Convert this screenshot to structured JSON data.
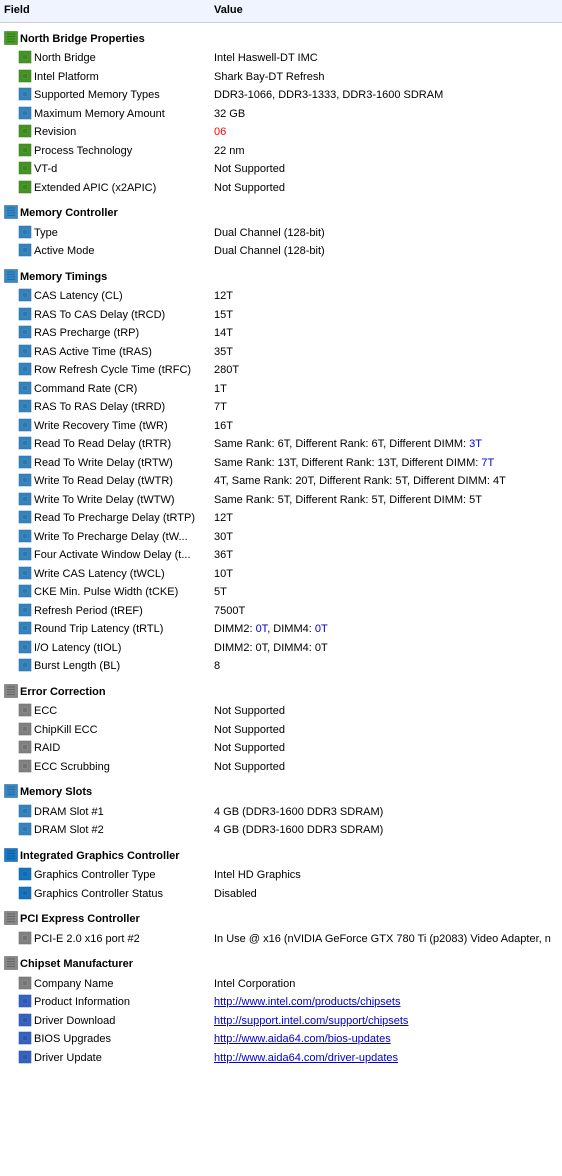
{
  "columns": {
    "field": "Field",
    "value": "Value"
  },
  "sections": [
    {
      "id": "north-bridge-properties",
      "label": "North Bridge Properties",
      "icon": "chip",
      "indent": 0,
      "rows": [
        {
          "field": "North Bridge",
          "value": "Intel Haswell-DT IMC",
          "indent": 1,
          "icon": "chip"
        },
        {
          "field": "Intel Platform",
          "value": "Shark Bay-DT Refresh",
          "indent": 1,
          "icon": "chip"
        },
        {
          "field": "Supported Memory Types",
          "value": "DDR3-1066, DDR3-1333, DDR3-1600 SDRAM",
          "indent": 1,
          "icon": "timing",
          "valueHighlight": "DDR3-1600"
        },
        {
          "field": "Maximum Memory Amount",
          "value": "32 GB",
          "indent": 1,
          "icon": "timing"
        },
        {
          "field": "Revision",
          "value": "06",
          "indent": 1,
          "icon": "chip",
          "valueColor": "red"
        },
        {
          "field": "Process Technology",
          "value": "22 nm",
          "indent": 1,
          "icon": "chip"
        },
        {
          "field": "VT-d",
          "value": "Not Supported",
          "indent": 1,
          "icon": "chip"
        },
        {
          "field": "Extended APIC (x2APIC)",
          "value": "Not Supported",
          "indent": 1,
          "icon": "chip"
        }
      ]
    },
    {
      "id": "memory-controller",
      "label": "Memory Controller",
      "icon": "timing",
      "indent": 0,
      "rows": [
        {
          "field": "Type",
          "value": "Dual Channel  (128-bit)",
          "indent": 1,
          "icon": "timing"
        },
        {
          "field": "Active Mode",
          "value": "Dual Channel  (128-bit)",
          "indent": 1,
          "icon": "timing"
        }
      ]
    },
    {
      "id": "memory-timings",
      "label": "Memory Timings",
      "icon": "timing",
      "indent": 0,
      "rows": [
        {
          "field": "CAS Latency (CL)",
          "value": "12T",
          "indent": 1,
          "icon": "timing"
        },
        {
          "field": "RAS To CAS Delay (tRCD)",
          "value": "15T",
          "indent": 1,
          "icon": "timing"
        },
        {
          "field": "RAS Precharge (tRP)",
          "value": "14T",
          "indent": 1,
          "icon": "timing"
        },
        {
          "field": "RAS Active Time (tRAS)",
          "value": "35T",
          "indent": 1,
          "icon": "timing"
        },
        {
          "field": "Row Refresh Cycle Time (tRFC)",
          "value": "280T",
          "indent": 1,
          "icon": "timing"
        },
        {
          "field": "Command Rate (CR)",
          "value": "1T",
          "indent": 1,
          "icon": "timing"
        },
        {
          "field": "RAS To RAS Delay (tRRD)",
          "value": "7T",
          "indent": 1,
          "icon": "timing"
        },
        {
          "field": "Write Recovery Time (tWR)",
          "value": "16T",
          "indent": 1,
          "icon": "timing"
        },
        {
          "field": "Read To Read Delay (tRTR)",
          "value": "Same Rank: 6T, Different Rank: 6T, Different DIMM: 3T",
          "indent": 1,
          "icon": "timing",
          "partialBlue": "3T"
        },
        {
          "field": "Read To Write Delay (tRTW)",
          "value": "Same Rank: 13T, Different Rank: 13T, Different DIMM: 7T",
          "indent": 1,
          "icon": "timing",
          "partialBlue": "7T"
        },
        {
          "field": "Write To Read Delay (tWTR)",
          "value": "4T, Same Rank: 20T, Different Rank: 5T, Different DIMM: 4T",
          "indent": 1,
          "icon": "timing"
        },
        {
          "field": "Write To Write Delay (tWTW)",
          "value": "Same Rank: 5T, Different Rank: 5T, Different DIMM: 5T",
          "indent": 1,
          "icon": "timing"
        },
        {
          "field": "Read To Precharge Delay (tRTP)",
          "value": "12T",
          "indent": 1,
          "icon": "timing"
        },
        {
          "field": "Write To Precharge Delay (tW...",
          "value": "30T",
          "indent": 1,
          "icon": "timing"
        },
        {
          "field": "Four Activate Window Delay (t...",
          "value": "36T",
          "indent": 1,
          "icon": "timing"
        },
        {
          "field": "Write CAS Latency (tWCL)",
          "value": "10T",
          "indent": 1,
          "icon": "timing"
        },
        {
          "field": "CKE Min. Pulse Width (tCKE)",
          "value": "5T",
          "indent": 1,
          "icon": "timing"
        },
        {
          "field": "Refresh Period (tREF)",
          "value": "7500T",
          "indent": 1,
          "icon": "timing"
        },
        {
          "field": "Round Trip Latency (tRTL)",
          "value": "DIMM2: 0T, DIMM4: 0T",
          "indent": 1,
          "icon": "timing",
          "partialBlue": "0T"
        },
        {
          "field": "I/O Latency (tIOL)",
          "value": "DIMM2: 0T, DIMM4: 0T",
          "indent": 1,
          "icon": "timing"
        },
        {
          "field": "Burst Length (BL)",
          "value": "8",
          "indent": 1,
          "icon": "timing"
        }
      ]
    },
    {
      "id": "error-correction",
      "label": "Error Correction",
      "icon": "error",
      "indent": 0,
      "rows": [
        {
          "field": "ECC",
          "value": "Not Supported",
          "indent": 1,
          "icon": "error"
        },
        {
          "field": "ChipKill ECC",
          "value": "Not Supported",
          "indent": 1,
          "icon": "error"
        },
        {
          "field": "RAID",
          "value": "Not Supported",
          "indent": 1,
          "icon": "error"
        },
        {
          "field": "ECC Scrubbing",
          "value": "Not Supported",
          "indent": 1,
          "icon": "error"
        }
      ]
    },
    {
      "id": "memory-slots",
      "label": "Memory Slots",
      "icon": "timing",
      "indent": 0,
      "rows": [
        {
          "field": "DRAM Slot #1",
          "value": "4 GB  (DDR3-1600 DDR3 SDRAM)",
          "indent": 1,
          "icon": "slot"
        },
        {
          "field": "DRAM Slot #2",
          "value": "4 GB  (DDR3-1600 DDR3 SDRAM)",
          "indent": 1,
          "icon": "slot"
        }
      ]
    },
    {
      "id": "integrated-graphics",
      "label": "Integrated Graphics Controller",
      "icon": "gpu",
      "indent": 0,
      "rows": [
        {
          "field": "Graphics Controller Type",
          "value": "Intel HD Graphics",
          "indent": 1,
          "icon": "gpu"
        },
        {
          "field": "Graphics Controller Status",
          "value": "Disabled",
          "indent": 1,
          "icon": "gpu"
        }
      ]
    },
    {
      "id": "pci-express",
      "label": "PCI Express Controller",
      "icon": "pci",
      "indent": 0,
      "rows": [
        {
          "field": "PCI-E 2.0 x16 port #2",
          "value": "In Use @ x16  (nVIDIA GeForce GTX 780 Ti (p2083) Video Adapter, n",
          "indent": 1,
          "icon": "pci"
        }
      ]
    },
    {
      "id": "chipset-manufacturer",
      "label": "Chipset Manufacturer",
      "icon": "mfg",
      "indent": 0,
      "rows": [
        {
          "field": "Company Name",
          "value": "Intel Corporation",
          "indent": 1,
          "icon": "mfg"
        },
        {
          "field": "Product Information",
          "value": "http://www.intel.com/products/chipsets",
          "indent": 1,
          "icon": "info",
          "isLink": true
        },
        {
          "field": "Driver Download",
          "value": "http://support.intel.com/support/chipsets",
          "indent": 1,
          "icon": "info",
          "isLink": true
        },
        {
          "field": "BIOS Upgrades",
          "value": "http://www.aida64.com/bios-updates",
          "indent": 1,
          "icon": "info",
          "isLink": true
        },
        {
          "field": "Driver Update",
          "value": "http://www.aida64.com/driver-updates",
          "indent": 1,
          "icon": "info",
          "isLink": true
        }
      ]
    }
  ]
}
